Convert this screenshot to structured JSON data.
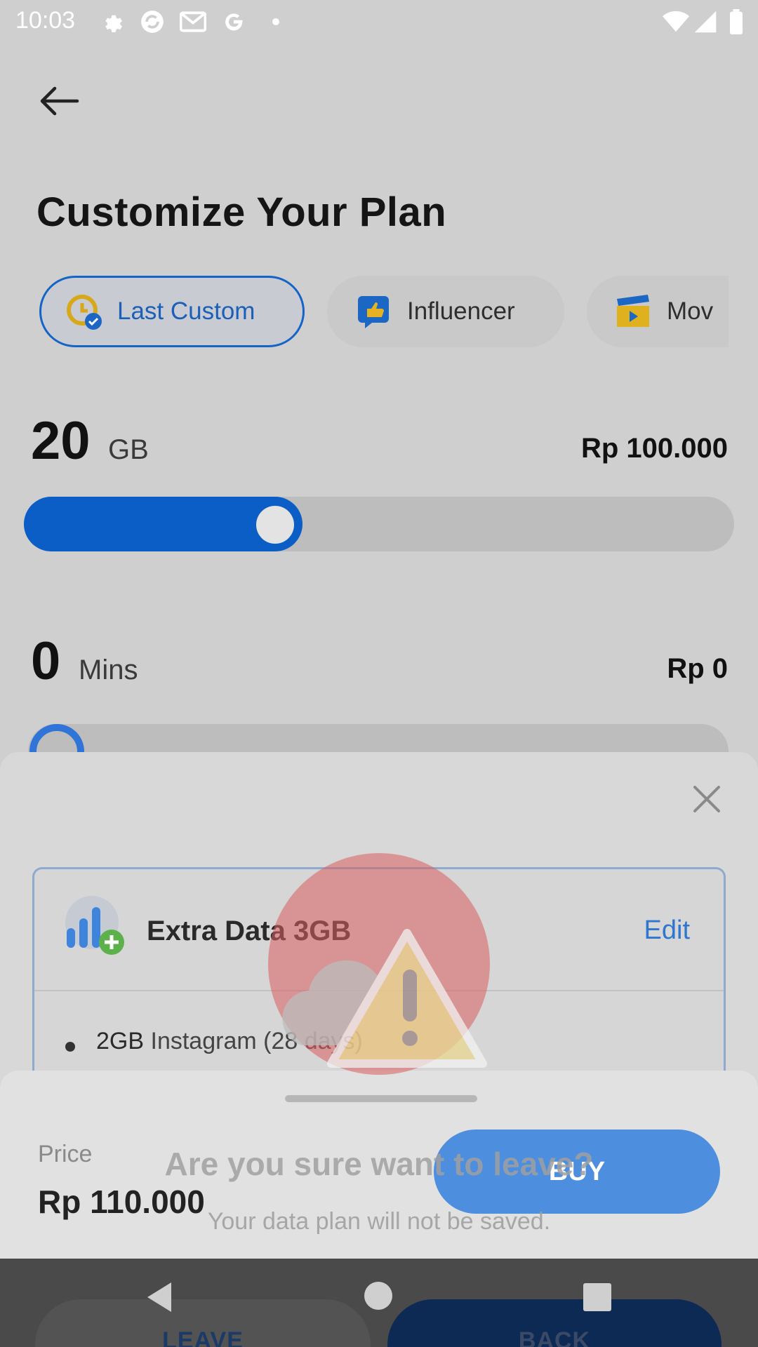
{
  "status_bar": {
    "time": "10:03",
    "left_icons": [
      "settings-icon",
      "sync-icon",
      "gmail-icon",
      "google-icon",
      "dot-icon"
    ],
    "right_icons": [
      "wifi-icon",
      "signal-icon",
      "battery-icon"
    ]
  },
  "page": {
    "title": "Customize Your Plan",
    "chips": [
      {
        "label": "Last Custom",
        "icon": "clock-check-icon",
        "active": true
      },
      {
        "label": "Influencer",
        "icon": "thumbs-up-icon",
        "active": false
      },
      {
        "label": "Mov",
        "icon": "movie-icon",
        "active": false
      }
    ],
    "data": {
      "amount": "20",
      "unit": "GB",
      "price": "Rp 100.000",
      "slider_fraction": 0.38
    },
    "voice": {
      "amount": "0",
      "unit": "Mins",
      "price": "Rp 0",
      "slider_fraction": 0
    }
  },
  "sheet": {
    "extra_title": "Extra Data 3GB",
    "edit_label": "Edit",
    "items": [
      {
        "amount": "2GB",
        "text": "Instagram (28 days)"
      }
    ]
  },
  "footer": {
    "price_label": "Price",
    "price_value": "Rp 110.000",
    "buy_label": "BUY"
  },
  "leave_dialog": {
    "title": "Are you sure want to leave?",
    "subtitle": "Your data plan will not be saved.",
    "leave_label": "LEAVE",
    "back_label": "BACK"
  },
  "colors": {
    "accent": "#0a5ec5",
    "buy": "#4d8ede",
    "warning_circle": "#db5e5e",
    "edit_link": "#2f76cf"
  }
}
